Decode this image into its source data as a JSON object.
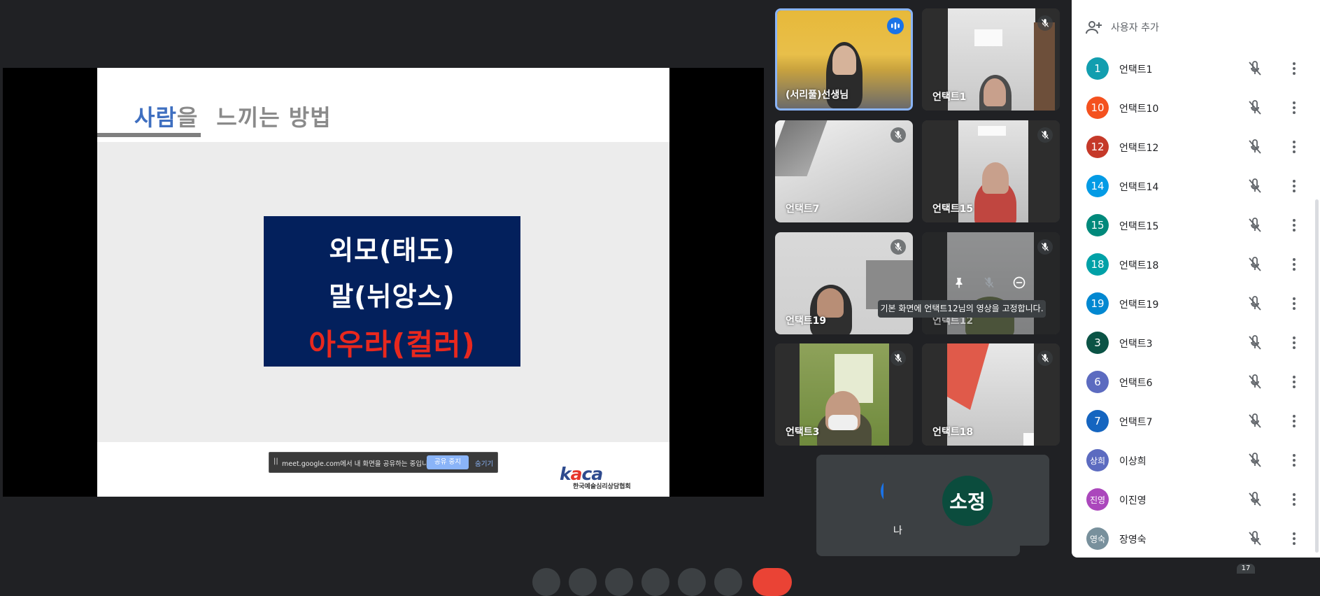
{
  "slide": {
    "title_highlight": "사람",
    "title_particle": "을",
    "title_rest": "느끼는 방법",
    "box_lines": [
      "외모(태도)",
      "말(뉘앙스)",
      "아우라(컬러)"
    ],
    "logo_text_k": "k",
    "logo_text_o": "a",
    "logo_text_rest": "ca",
    "logo_subtitle": "한국예술심리상담협회"
  },
  "share_bar": {
    "handle": "||",
    "message": "meet.google.com에서 내 화면을 공유하는 중입니다.",
    "stop_label": "공유 중지",
    "hide_label": "숨기기"
  },
  "tiles": [
    {
      "name": "(서리풀)선생님",
      "state": "speaking"
    },
    {
      "name": "언택트1",
      "state": "muted"
    },
    {
      "name": "언택트7",
      "state": "muted"
    },
    {
      "name": "언택트15",
      "state": "muted"
    },
    {
      "name": "언택트19",
      "state": "muted"
    },
    {
      "name": "언택트12",
      "state": "muted"
    },
    {
      "name": "언택트3",
      "state": "muted"
    },
    {
      "name": "언택트18",
      "state": "muted"
    }
  ],
  "tooltip": "기본 화면에 언택트12님의 영상을 고정합니다.",
  "self": {
    "back_label": "나",
    "avatar_initials": "소정",
    "label": "나"
  },
  "people_panel": {
    "add_people_label": "사용자 추가",
    "participant_count": "17",
    "people": [
      {
        "avatar": "1",
        "name": "언택트1",
        "color": "#129eaf"
      },
      {
        "avatar": "10",
        "name": "언택트10",
        "color": "#f4511e"
      },
      {
        "avatar": "12",
        "name": "언택트12",
        "color": "#c53929"
      },
      {
        "avatar": "14",
        "name": "언택트14",
        "color": "#039be5"
      },
      {
        "avatar": "15",
        "name": "언택트15",
        "color": "#00897b"
      },
      {
        "avatar": "18",
        "name": "언택트18",
        "color": "#00a1a7"
      },
      {
        "avatar": "19",
        "name": "언택트19",
        "color": "#0288d1"
      },
      {
        "avatar": "3",
        "name": "언택트3",
        "color": "#0b5345"
      },
      {
        "avatar": "6",
        "name": "언택트6",
        "color": "#5c6bc0"
      },
      {
        "avatar": "7",
        "name": "언택트7",
        "color": "#1565c0"
      },
      {
        "avatar": "상희",
        "name": "이상희",
        "color": "#5c6bc0"
      },
      {
        "avatar": "진영",
        "name": "이진영",
        "color": "#ab47bc"
      },
      {
        "avatar": "영숙",
        "name": "장영숙",
        "color": "#78909c"
      }
    ]
  }
}
